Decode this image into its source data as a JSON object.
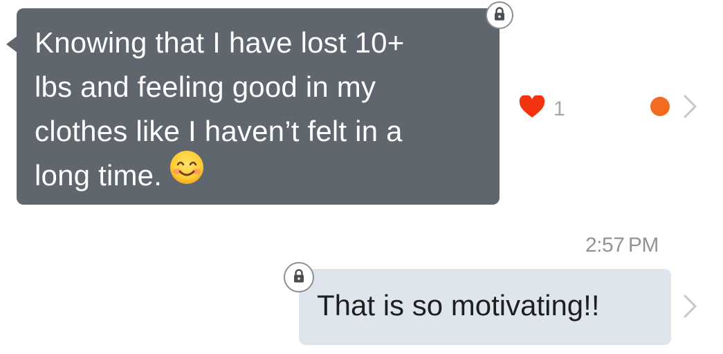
{
  "incoming_message": {
    "lines": [
      "Knowing that I have lost 10+",
      "lbs and feeling good in my",
      "clothes like I haven’t felt in a",
      "long time."
    ],
    "emoji": "smiling-face-with-smiling-eyes"
  },
  "reaction": {
    "icon": "heart-icon",
    "count": "1",
    "color": "#f1330f"
  },
  "unread_indicator_color": "#f26b21",
  "timestamp": "2:57 PM",
  "outgoing_message": {
    "text": "That is so motivating!!"
  },
  "colors": {
    "incoming_bubble": "#5f666e",
    "outgoing_bubble": "#dfe5ed"
  }
}
